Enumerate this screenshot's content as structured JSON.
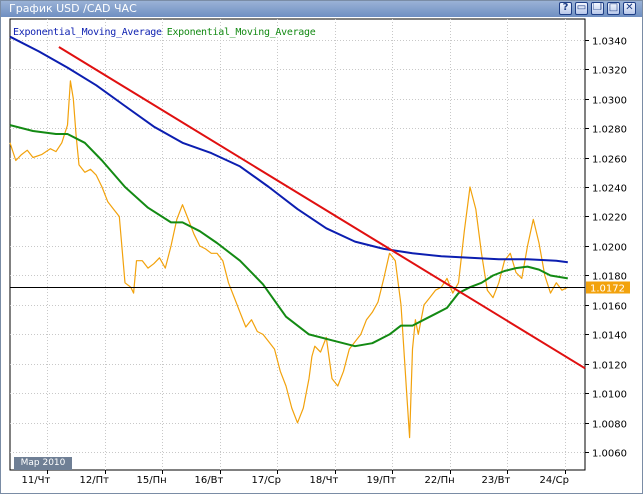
{
  "window": {
    "title": "График USD /CAD  ЧАС",
    "buttons": [
      {
        "name": "help-button",
        "glyph": "?"
      },
      {
        "name": "minimize-button",
        "glyph": "▭"
      },
      {
        "name": "restore-button",
        "glyph": "❐"
      },
      {
        "name": "maximize-button",
        "glyph": "□"
      },
      {
        "name": "close-button",
        "glyph": "✕"
      }
    ]
  },
  "period_badge": "Map 2010",
  "colors": {
    "background": "#ffffff",
    "price": "#f2a20c",
    "ema_slow": "#0c1eb0",
    "ema_fast": "#138a13",
    "trendline": "#e01010",
    "price_line": "#000000",
    "current_price_label": "#f2a20c"
  },
  "chart_data": {
    "type": "line",
    "title": "",
    "legend": [
      {
        "label": "Exponential_Moving_Average",
        "color": "#0c1eb0"
      },
      {
        "label": "Exponential_Moving_Average",
        "color": "#138a13"
      }
    ],
    "x_ticks": [
      "11/Чт",
      "12/Пт",
      "15/Пн",
      "16/Вт",
      "17/Ср",
      "18/Чт",
      "19/Пт",
      "22/Пн",
      "23/Вт",
      "24/Ср"
    ],
    "y_ticks": [
      "1.0060",
      "1.0080",
      "1.0100",
      "1.0120",
      "1.0140",
      "1.0160",
      "1.0180",
      "1.0200",
      "1.0220",
      "1.0240",
      "1.0260",
      "1.0280",
      "1.0300",
      "1.0320",
      "1.0340"
    ],
    "ylim": [
      1.0048,
      1.0354
    ],
    "xlim": [
      0,
      1
    ],
    "current_price": {
      "value": 1.0172,
      "label": "1.0172"
    },
    "series": [
      {
        "kind": "price",
        "color": "#f2a20c",
        "x": [
          0,
          0.01,
          0.02,
          0.03,
          0.04,
          0.055,
          0.07,
          0.08,
          0.09,
          0.1,
          0.105,
          0.11,
          0.115,
          0.12,
          0.13,
          0.14,
          0.15,
          0.16,
          0.17,
          0.18,
          0.19,
          0.2,
          0.21,
          0.215,
          0.22,
          0.23,
          0.24,
          0.25,
          0.26,
          0.27,
          0.28,
          0.29,
          0.3,
          0.31,
          0.32,
          0.33,
          0.34,
          0.35,
          0.36,
          0.37,
          0.38,
          0.39,
          0.4,
          0.41,
          0.42,
          0.43,
          0.44,
          0.45,
          0.46,
          0.47,
          0.48,
          0.49,
          0.5,
          0.51,
          0.52,
          0.525,
          0.53,
          0.54,
          0.55,
          0.56,
          0.57,
          0.58,
          0.59,
          0.6,
          0.61,
          0.62,
          0.63,
          0.64,
          0.65,
          0.66,
          0.67,
          0.68,
          0.69,
          0.695,
          0.7,
          0.705,
          0.71,
          0.72,
          0.73,
          0.74,
          0.75,
          0.76,
          0.77,
          0.78,
          0.79,
          0.8,
          0.81,
          0.82,
          0.83,
          0.84,
          0.85,
          0.86,
          0.87,
          0.88,
          0.89,
          0.9,
          0.91,
          0.92,
          0.93,
          0.94,
          0.95,
          0.96,
          0.97
        ],
        "y": [
          1.027,
          1.0258,
          1.0262,
          1.0265,
          1.026,
          1.0262,
          1.0266,
          1.0264,
          1.027,
          1.0282,
          1.0312,
          1.03,
          1.0275,
          1.0255,
          1.025,
          1.0252,
          1.0248,
          1.024,
          1.023,
          1.0225,
          1.022,
          1.0175,
          1.0172,
          1.0168,
          1.019,
          1.019,
          1.0185,
          1.0188,
          1.0192,
          1.0185,
          1.02,
          1.0218,
          1.0228,
          1.0218,
          1.0208,
          1.02,
          1.0198,
          1.0195,
          1.0195,
          1.019,
          1.0175,
          1.0165,
          1.0155,
          1.0145,
          1.015,
          1.0142,
          1.014,
          1.0135,
          1.013,
          1.0115,
          1.0105,
          1.009,
          1.008,
          1.009,
          1.011,
          1.0125,
          1.0132,
          1.0128,
          1.0138,
          1.011,
          1.0105,
          1.0115,
          1.013,
          1.0135,
          1.014,
          1.015,
          1.0155,
          1.0162,
          1.0178,
          1.0195,
          1.019,
          1.016,
          1.01,
          1.007,
          1.013,
          1.015,
          1.014,
          1.016,
          1.0165,
          1.017,
          1.0172,
          1.0178,
          1.0168,
          1.0175,
          1.021,
          1.024,
          1.0225,
          1.0195,
          1.017,
          1.0165,
          1.0175,
          1.019,
          1.0195,
          1.0182,
          1.0178,
          1.02,
          1.0218,
          1.0202,
          1.018,
          1.0168,
          1.0175,
          1.017,
          1.0172
        ]
      },
      {
        "kind": "ema_slow",
        "color": "#0c1eb0",
        "x": [
          0,
          0.05,
          0.1,
          0.15,
          0.2,
          0.25,
          0.3,
          0.35,
          0.4,
          0.45,
          0.5,
          0.55,
          0.6,
          0.65,
          0.7,
          0.75,
          0.8,
          0.85,
          0.9,
          0.95,
          0.97
        ],
        "y": [
          1.0342,
          1.0332,
          1.0321,
          1.0309,
          1.0295,
          1.0281,
          1.027,
          1.0263,
          1.0254,
          1.024,
          1.0225,
          1.0212,
          1.0203,
          1.0198,
          1.0195,
          1.0193,
          1.0192,
          1.0191,
          1.0191,
          1.019,
          1.0189
        ]
      },
      {
        "kind": "ema_fast",
        "color": "#138a13",
        "x": [
          0,
          0.04,
          0.08,
          0.1,
          0.13,
          0.16,
          0.2,
          0.24,
          0.28,
          0.3,
          0.33,
          0.36,
          0.4,
          0.44,
          0.48,
          0.52,
          0.56,
          0.6,
          0.63,
          0.66,
          0.68,
          0.7,
          0.72,
          0.74,
          0.76,
          0.78,
          0.8,
          0.82,
          0.84,
          0.86,
          0.88,
          0.9,
          0.92,
          0.94,
          0.97
        ],
        "y": [
          1.0282,
          1.0278,
          1.0276,
          1.0276,
          1.027,
          1.0258,
          1.024,
          1.0226,
          1.0216,
          1.0216,
          1.021,
          1.0202,
          1.019,
          1.0174,
          1.0152,
          1.014,
          1.0136,
          1.0132,
          1.0134,
          1.014,
          1.0146,
          1.0146,
          1.015,
          1.0154,
          1.0158,
          1.0168,
          1.0172,
          1.0175,
          1.018,
          1.0183,
          1.0185,
          1.0186,
          1.0184,
          1.018,
          1.0178
        ]
      },
      {
        "kind": "trendline",
        "color": "#e01010",
        "x": [
          0.085,
          1.0
        ],
        "y": [
          1.0335,
          1.0117
        ]
      }
    ]
  }
}
